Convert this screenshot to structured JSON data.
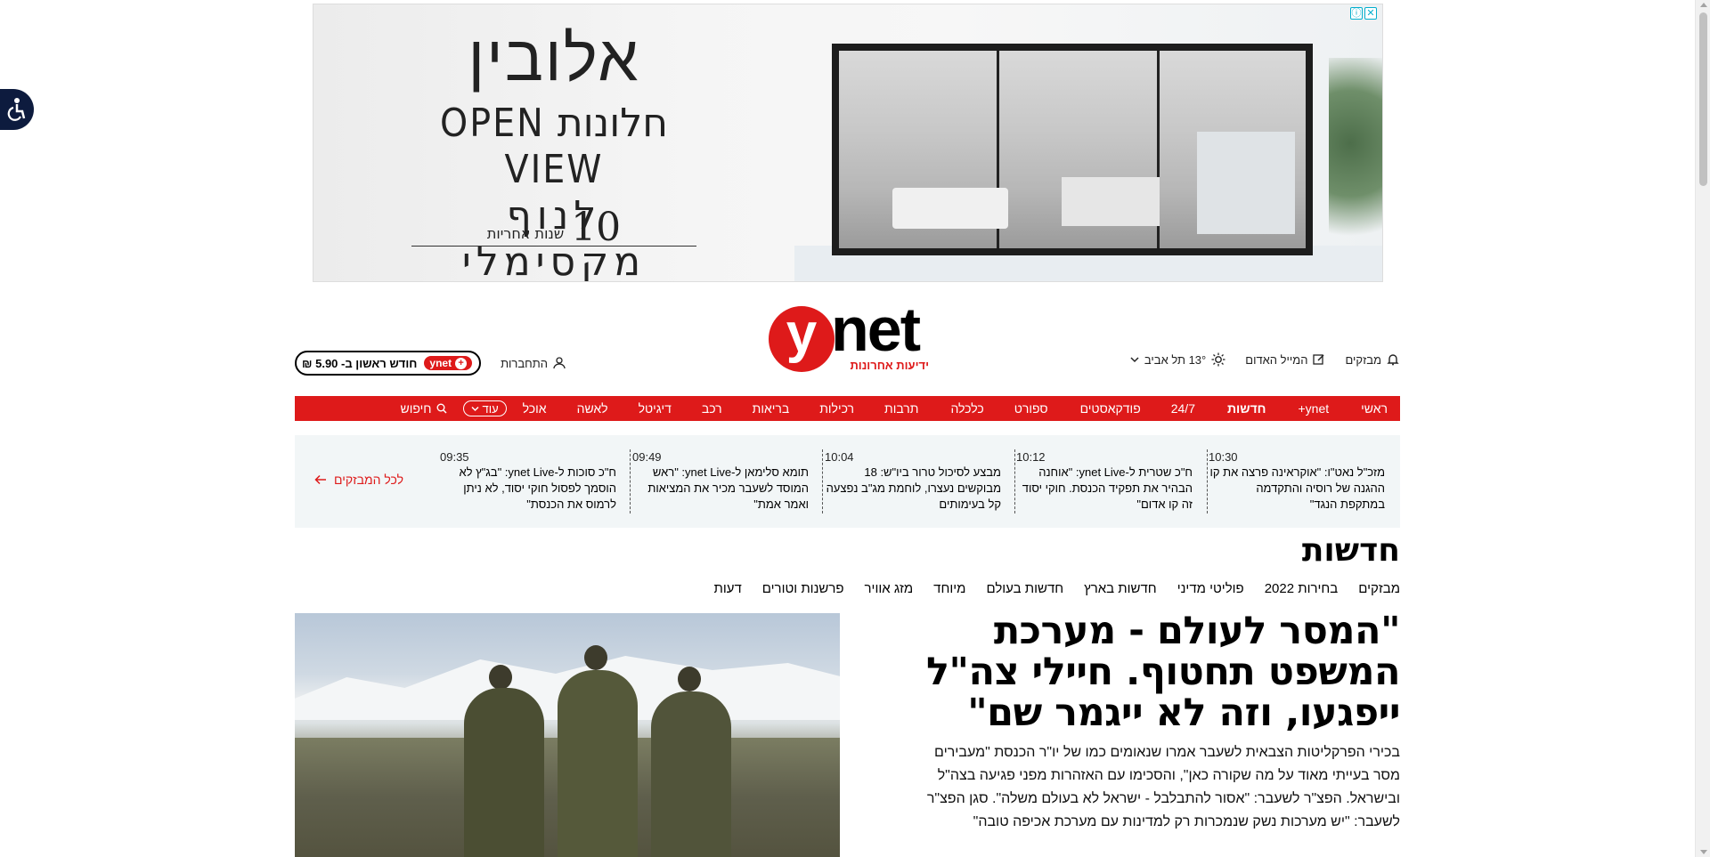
{
  "ad": {
    "brand": "אלובין",
    "line2_hebrew": "חלונות",
    "line2_latin": "OPEN VIEW",
    "line3": "לנוף מקסימלי",
    "years_number": "10",
    "years_text": "שנות אחריות",
    "info_icon": "ⓘ",
    "close_icon": "✕"
  },
  "header": {
    "logo_text": "net",
    "logo_letter": "y",
    "logo_tagline": "ידיעות אחרונות",
    "flashes_link": "מבזקים",
    "red_mail": "המייל האדום",
    "weather": "13° תל אביב",
    "login": "התחברות",
    "subscribe_pill": "ynet",
    "subscribe_text": "חודש ראשון ב- 5.90 ₪"
  },
  "nav": {
    "items": [
      "ראשי",
      "ynet+",
      "חדשות",
      "24/7",
      "פודקאסטים",
      "ספורט",
      "כלכלה",
      "תרבות",
      "רכילות",
      "בריאות",
      "רכב",
      "דיגיטל",
      "לאשה",
      "אוכל"
    ],
    "active_index": 2,
    "more_label": "עוד",
    "search_label": "חיפוש"
  },
  "breaking": {
    "all_label": "לכל המבזקים",
    "items": [
      {
        "time": "10:30",
        "text": "מזכ\"ל נאט\"ו: \"אוקראינה פרצה את קו ההגנה של רוסיה והתקדמה במתקפת הנגד\""
      },
      {
        "time": "10:12",
        "text": "ח\"כ שטרית ל-ynet Live: \"אוחנה הבהיר את תפקיד הכנסת. חוקי יסוד זה קו אדום\""
      },
      {
        "time": "10:04",
        "text": "מבצע לסיכול טרור ביו\"ש: 18 מבוקשים נעצרו, לוחמת מג\"ב נפצעה קל בעימותים"
      },
      {
        "time": "09:49",
        "text": "תומא סלימאן ל-ynet Live: \"ראש המוסד לשעבר מכיר את המציאות ואמר אמת\""
      },
      {
        "time": "09:35",
        "text": "ח\"כ סוכות ל-ynet Live: \"בג\"ץ לא הוסמך לפסול חוקי יסוד, לא ניתן לרמוס את הכנסת\""
      }
    ]
  },
  "section": {
    "title": "חדשות",
    "subnav": [
      "מבזקים",
      "בחירות 2022",
      "פוליטי מדיני",
      "חדשות בארץ",
      "חדשות בעולם",
      "מיוחד",
      "מזג אוויר",
      "פרשנות וטורים",
      "דעות"
    ]
  },
  "main_story": {
    "headline": "\"המסר לעולם - מערכת המשפט תחטוף. חיילי צה\"ל ייפגעו, וזה לא ייגמר שם\"",
    "summary": "בכירי הפרקליטות הצבאית לשעבר אמרו שנאומים כמו של יו\"ר הכנסת \"מעבירים מסר בעייתי מאוד על מה שקורה כאן\", והסכימו עם האזהרות מפני פגיעה בצה\"ל ובישראל. הפצ\"ר לשעבר: \"אסור להתבלבל - ישראל לא בעולם משלה\". סגן הפצ\"ר לשעבר: \"יש מערכות נשק שנמכרות רק למדינות עם מערכת אכיפה טובה\""
  },
  "colors": {
    "brand_red": "#de1a1a",
    "strip_bg": "#f2f6f7",
    "a11y_bg": "#0d1b3e"
  }
}
